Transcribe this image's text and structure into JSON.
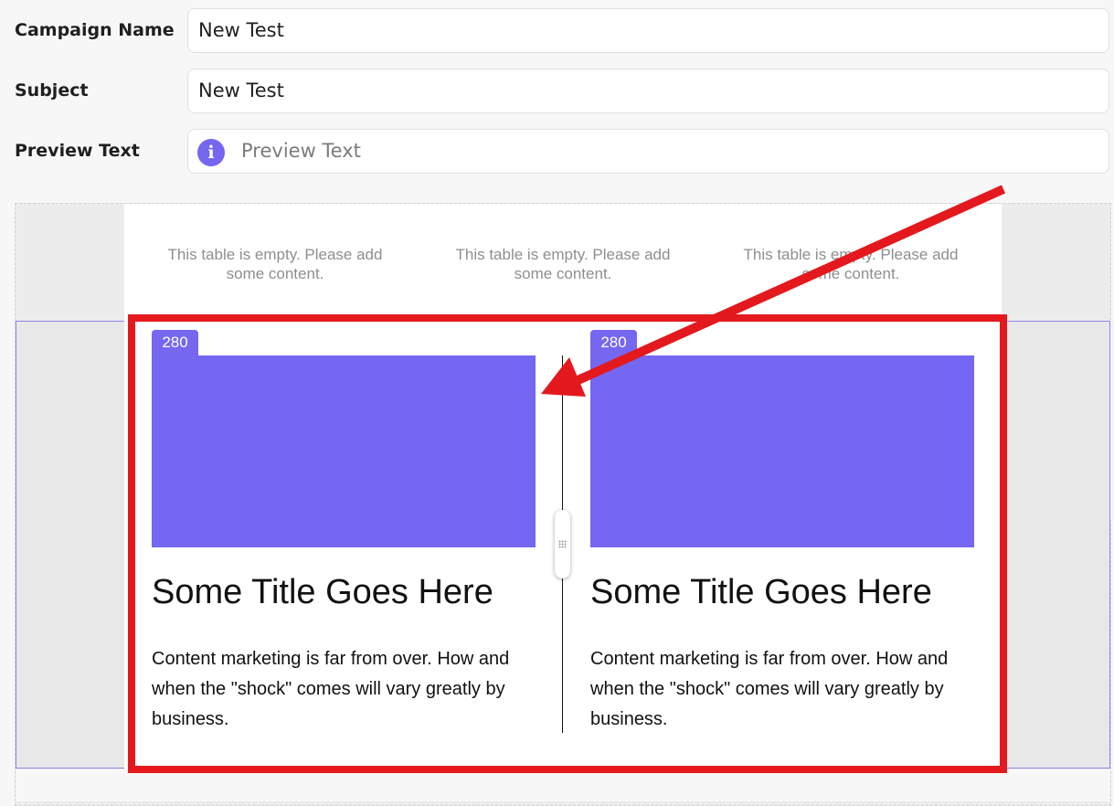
{
  "form": {
    "campaign_name_label": "Campaign Name",
    "campaign_name_value": "New Test",
    "subject_label": "Subject",
    "subject_value": "New Test",
    "preview_text_label": "Preview Text",
    "preview_text_placeholder": "Preview Text",
    "preview_text_value": "",
    "info_icon": "i"
  },
  "top_table": {
    "cells": [
      "This table is empty. Please add some content.",
      "This table is empty. Please add some content.",
      "This table is empty. Please add some content."
    ]
  },
  "columns": [
    {
      "width_badge": "280",
      "title": "Some Title Goes Here",
      "body": "Content marketing is far from over. How and when the \"shock\" comes will vary greatly by business."
    },
    {
      "width_badge": "280",
      "title": "Some Title Goes Here",
      "body": "Content marketing is far from over. How and when the \"shock\" comes will vary greatly by business."
    }
  ],
  "colors": {
    "accent": "#7567f0",
    "image_placeholder": "#7467f2",
    "annotation_red": "#e3191e"
  },
  "icons": {
    "info": "info-icon",
    "resize_handle": "resize-handle-icon",
    "annotation_arrow": "arrow-icon"
  }
}
